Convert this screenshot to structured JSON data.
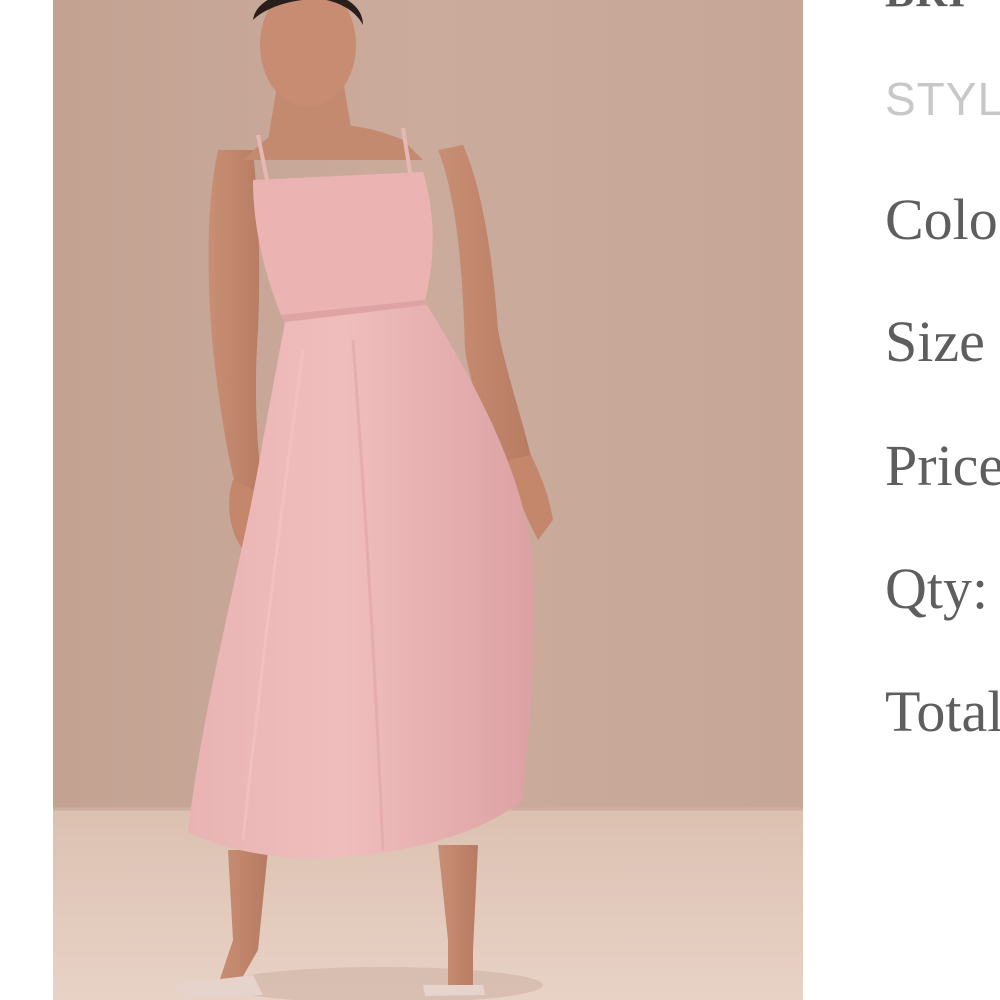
{
  "product": {
    "title_partial": "BRI",
    "style_label": "STYL",
    "fields": {
      "color": "Colo",
      "size": "Size",
      "price": "Price",
      "qty": "Qty:",
      "total": "Total"
    }
  },
  "colors": {
    "background_wall": "#c7a899",
    "floor": "#e2c9bb",
    "dress": "#e8aeb0",
    "text_primary": "#5e5e5e",
    "text_muted": "#c8c8c8"
  }
}
